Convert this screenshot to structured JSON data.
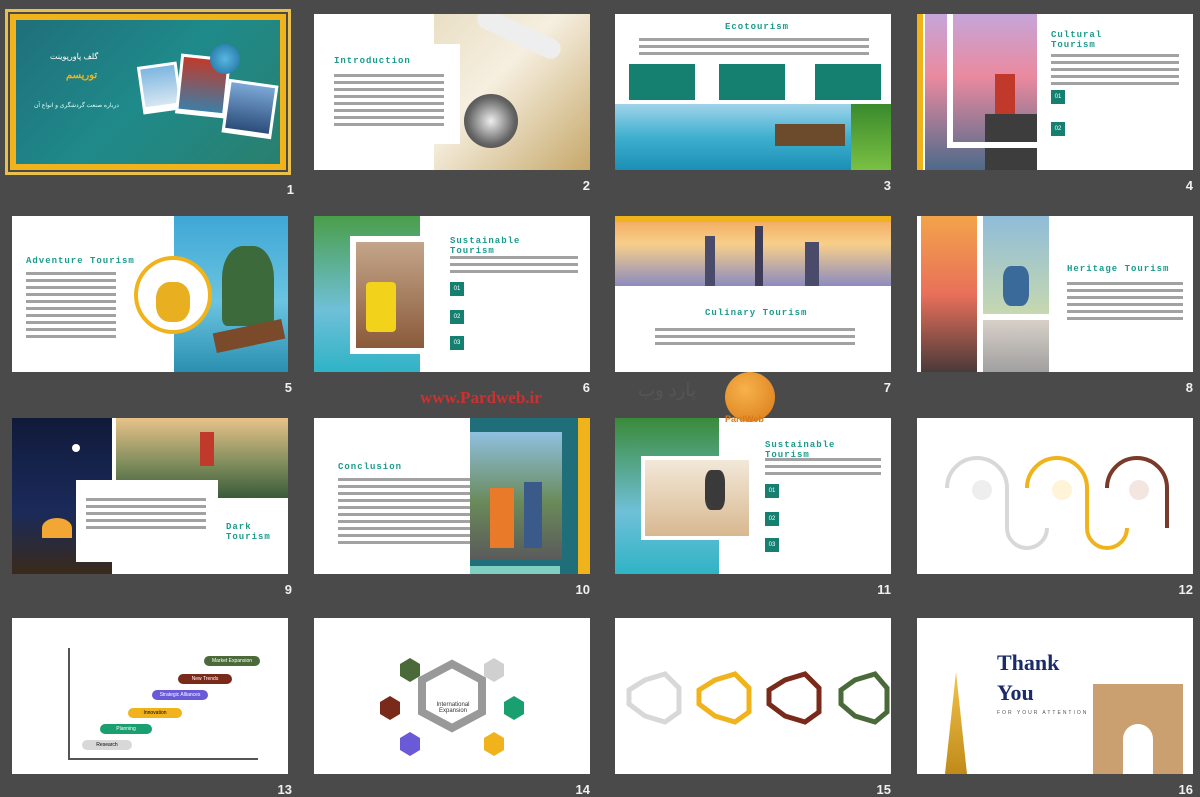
{
  "slides": [
    {
      "num": "1",
      "title": "گلف پاورپوینت",
      "subtitle": "توریسم",
      "desc": "درباره صنعت گردشگری و انواع آن"
    },
    {
      "num": "2",
      "title": "Introduction"
    },
    {
      "num": "3",
      "title": "Ecotourism"
    },
    {
      "num": "4",
      "title": "Cultural Tourism",
      "items": [
        "01",
        "02"
      ]
    },
    {
      "num": "5",
      "title": "Adventure Tourism"
    },
    {
      "num": "6",
      "title": "Sustainable Tourism",
      "items": [
        "01",
        "02",
        "03"
      ]
    },
    {
      "num": "7",
      "title": "Culinary Tourism"
    },
    {
      "num": "8",
      "title": "Heritage Tourism"
    },
    {
      "num": "9",
      "title": "Dark Tourism"
    },
    {
      "num": "10",
      "title": "Conclusion"
    },
    {
      "num": "11",
      "title": "Sustainable Tourism",
      "items": [
        "01",
        "02",
        "03"
      ]
    },
    {
      "num": "12"
    },
    {
      "num": "13"
    },
    {
      "num": "14",
      "center": "International Expansion"
    },
    {
      "num": "15"
    },
    {
      "num": "16",
      "title": "Thank You",
      "sub": "FOR YOUR ATTENTION"
    }
  ],
  "watermark": {
    "text": "www.Pardweb.ir",
    "fa": "پارد وب",
    "brand": "PardWeb"
  },
  "slide13": {
    "steps": [
      "Market Expansion",
      "New Trends",
      "Strategic Alliances",
      "Innovation",
      "Planning",
      "Research"
    ]
  }
}
